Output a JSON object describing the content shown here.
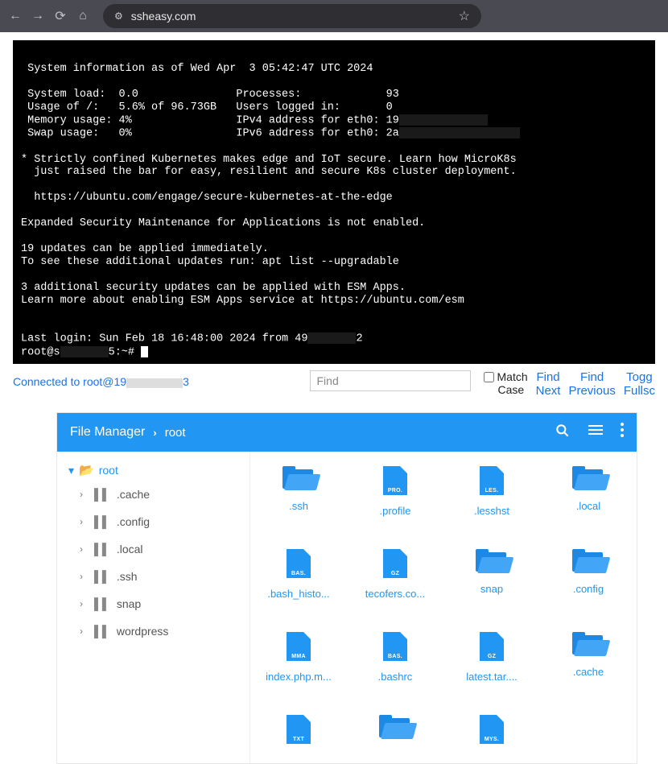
{
  "browser": {
    "url": "ssheasy.com"
  },
  "terminal": {
    "line01": " System information as of Wed Apr  3 05:42:47 UTC 2024",
    "line02": "",
    "line03": " System load:  0.0               Processes:             93",
    "line04": " Usage of /:   5.6% of 96.73GB   Users logged in:       0",
    "line05": " Memory usage: 4%                IPv4 address for eth0: 19",
    "line06": " Swap usage:   0%                IPv6 address for eth0: 2a",
    "line07": "",
    "line08": "* Strictly confined Kubernetes makes edge and IoT secure. Learn how MicroK8s",
    "line09": "  just raised the bar for easy, resilient and secure K8s cluster deployment.",
    "line10": "",
    "line11": "  https://ubuntu.com/engage/secure-kubernetes-at-the-edge",
    "line12": "",
    "line13": "Expanded Security Maintenance for Applications is not enabled.",
    "line14": "",
    "line15": "19 updates can be applied immediately.",
    "line16": "To see these additional updates run: apt list --upgradable",
    "line17": "",
    "line18": "3 additional security updates can be applied with ESM Apps.",
    "line19": "Learn more about enabling ESM Apps service at https://ubuntu.com/esm",
    "line20": "",
    "line21": "",
    "last_login_pre": "Last login: Sun Feb 18 16:48:00 2024 from 49",
    "last_login_post": "2",
    "prompt_pre": "root@s",
    "prompt_post": "5:~# "
  },
  "status": {
    "connected": "Connected to root@19",
    "connected_tail": "3"
  },
  "findbar": {
    "placeholder": "Find",
    "match_case": "Match",
    "case_word": "Case",
    "find": "Find",
    "next": "Next",
    "find2": "Find",
    "previous": "Previous",
    "toggle": "Togg",
    "fullscreen": "Fullsc"
  },
  "fileManager": {
    "title": "File Manager",
    "location": "root",
    "sidebar": {
      "root": "root",
      "items": [
        {
          "label": ".cache"
        },
        {
          "label": ".config"
        },
        {
          "label": ".local"
        },
        {
          "label": ".ssh"
        },
        {
          "label": "snap"
        },
        {
          "label": "wordpress"
        }
      ]
    },
    "files": [
      {
        "name": ".ssh",
        "type": "folder-open"
      },
      {
        "name": ".profile",
        "type": "file",
        "tag": "PRO."
      },
      {
        "name": ".lesshst",
        "type": "file",
        "tag": "LES."
      },
      {
        "name": ".local",
        "type": "folder-open"
      },
      {
        "name": ".bash_histo...",
        "type": "file",
        "tag": "BAS."
      },
      {
        "name": "tecofers.co...",
        "type": "file",
        "tag": "GZ"
      },
      {
        "name": "snap",
        "type": "folder-open"
      },
      {
        "name": ".config",
        "type": "folder-open"
      },
      {
        "name": "index.php.m...",
        "type": "file",
        "tag": "MMA"
      },
      {
        "name": ".bashrc",
        "type": "file",
        "tag": "BAS."
      },
      {
        "name": "latest.tar....",
        "type": "file",
        "tag": "GZ"
      },
      {
        "name": ".cache",
        "type": "folder-open"
      },
      {
        "name": "",
        "type": "file",
        "tag": "TXT"
      },
      {
        "name": "",
        "type": "folder-open"
      },
      {
        "name": "",
        "type": "file",
        "tag": "MYS."
      }
    ]
  }
}
